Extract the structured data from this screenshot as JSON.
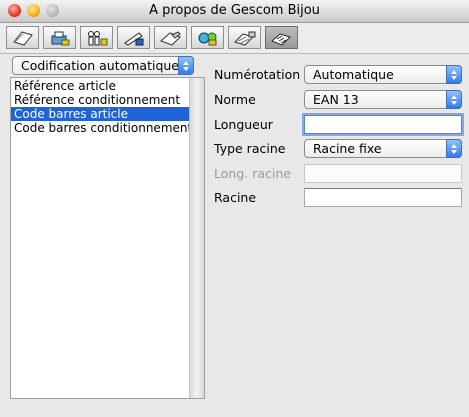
{
  "window": {
    "title": "A propos de Gescom Bijou"
  },
  "toolbar": {
    "buttons": [
      {
        "icon": "document-icon"
      },
      {
        "icon": "printer-disk-icon"
      },
      {
        "icon": "users-icon"
      },
      {
        "icon": "pencil-edit-icon"
      },
      {
        "icon": "hand-edit-icon"
      },
      {
        "icon": "globe-network-icon"
      },
      {
        "icon": "settings-hand-icon"
      },
      {
        "icon": "barcode-hand-icon",
        "selected": true
      }
    ]
  },
  "category_select": {
    "value": "Codification automatique"
  },
  "list": {
    "items": [
      "Référence article",
      "Référence conditionnement",
      "Code barres article",
      "Code barres conditionnement"
    ],
    "selected_index": 2
  },
  "form": {
    "numerotation": {
      "label": "Numérotation",
      "value": "Automatique"
    },
    "norme": {
      "label": "Norme",
      "value": "EAN 13"
    },
    "longueur": {
      "label": "Longueur",
      "value": ""
    },
    "type_racine": {
      "label": "Type racine",
      "value": "Racine fixe"
    },
    "long_racine": {
      "label": "Long. racine",
      "value": ""
    },
    "racine": {
      "label": "Racine",
      "value": ""
    }
  },
  "colors": {
    "selection": "#1f63d6",
    "popup_arrows": "#2f7bf2"
  }
}
